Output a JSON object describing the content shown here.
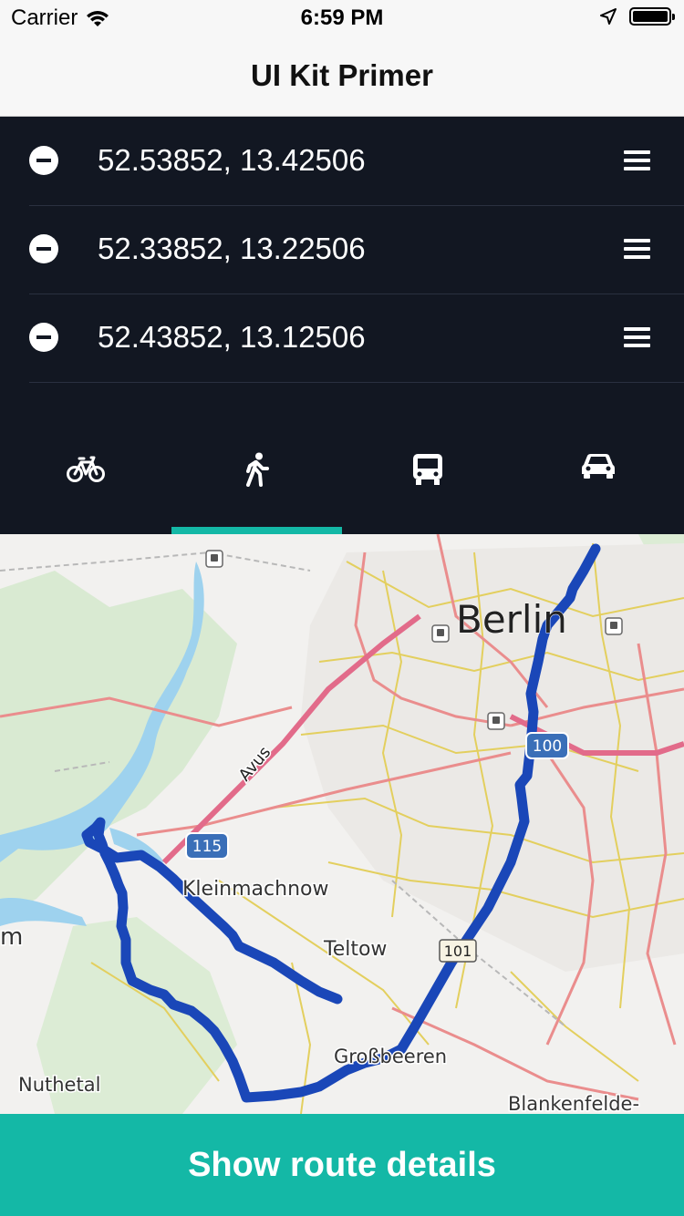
{
  "status_bar": {
    "carrier": "Carrier",
    "time": "6:59 PM"
  },
  "nav": {
    "title": "UI Kit Primer"
  },
  "waypoints": [
    {
      "coords": "52.53852, 13.42506"
    },
    {
      "coords": "52.33852, 13.22506"
    },
    {
      "coords": "52.43852, 13.12506"
    }
  ],
  "modes": [
    {
      "name": "bike",
      "icon": "bicycle-icon",
      "active": false
    },
    {
      "name": "walk",
      "icon": "walking-icon",
      "active": true
    },
    {
      "name": "transit",
      "icon": "bus-icon",
      "active": false
    },
    {
      "name": "car",
      "icon": "car-icon",
      "active": false
    }
  ],
  "map": {
    "labels": {
      "berlin": "Berlin",
      "kleinmachnow": "Kleinmachnow",
      "teltow": "Teltow",
      "grossbeeren": "Großbeeren",
      "nuthetal": "Nuthetal",
      "blankenfelde": "Blankenfelde-",
      "avus": "Avus",
      "partial": "m"
    },
    "shields": {
      "r100": "100",
      "r115": "115",
      "r101": "101"
    },
    "route_color": "#1a47b8"
  },
  "cta": {
    "label": "Show route details"
  },
  "colors": {
    "panel_bg": "#121722",
    "accent": "#14b8a6"
  }
}
